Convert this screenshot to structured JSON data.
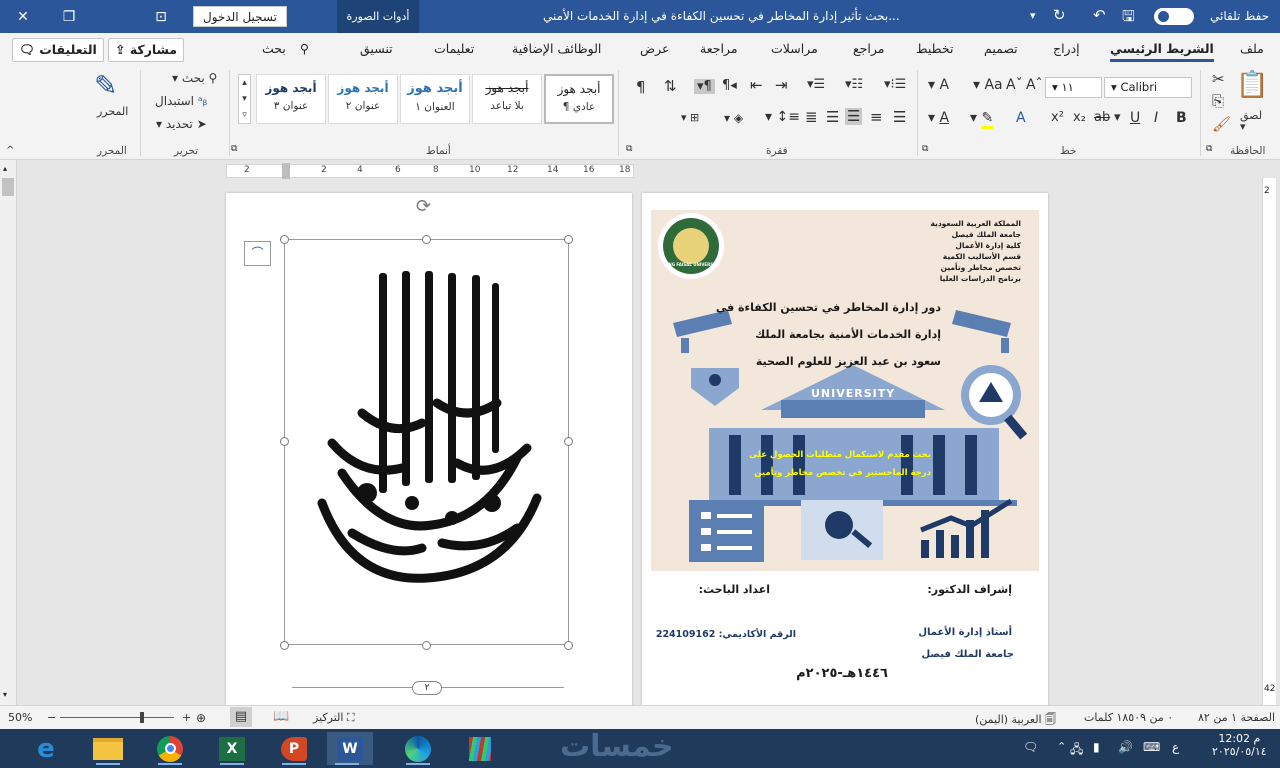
{
  "titlebar": {
    "autosave_label": "حفظ تلقائي",
    "doc_title": "بحث تأثير إدارة المخاطر في تحسين الكفاءة في إدارة الخدمات الأمني...",
    "image_tools": "أدوات الصورة",
    "signin": "تسجيل الدخول"
  },
  "tabs": [
    "ملف",
    "الشريط الرئيسي",
    "إدراج",
    "تصميم",
    "تخطيط",
    "مراجع",
    "مراسلات",
    "مراجعة",
    "عرض",
    "الوظائف الإضافية",
    "تعليمات",
    "تنسيق"
  ],
  "search_label": "بحث",
  "share_label": "مشاركة",
  "comments_label": "التعليقات",
  "ribbon": {
    "clipboard": {
      "paste": "لصق",
      "group": "الحافظة"
    },
    "font": {
      "name": "Calibri",
      "size": "١١",
      "group": "خط"
    },
    "paragraph": {
      "group": "فقرة"
    },
    "styles": {
      "items": [
        {
          "sample": "أبجد هوز",
          "name": "¶ عادي"
        },
        {
          "sample": "أبجد هوز",
          "name": "بلا تباعد"
        },
        {
          "sample": "أبجد هوز",
          "name": "العنوان ١"
        },
        {
          "sample": "أبجد هوز",
          "name": "عنوان ٢"
        },
        {
          "sample": "أبجد هوز",
          "name": "عنوان ٣"
        }
      ],
      "group": "أنماط"
    },
    "editing": {
      "find": "بحث",
      "replace": "استبدال",
      "select": "تحديد",
      "group": "تحرير"
    },
    "editor": {
      "label": "المحرر",
      "group": "المحرر"
    }
  },
  "ruler_ticks": [
    "18",
    "16",
    "14",
    "12",
    "10",
    "8",
    "6",
    "4",
    "2",
    "2"
  ],
  "vruler_ticks": [
    "2",
    "42"
  ],
  "cover": {
    "institution": [
      "المملكة العربية السعودية",
      "جامعة الملك فيصل",
      "كلية إدارة الأعمال",
      "قسم الأساليب الكمية",
      "تخصص مخاطر وتأمين",
      "برنامج الدراسات العليا"
    ],
    "logo_text": "KING FAISAL UNIVERSITY",
    "title_lines": [
      "دور إدارة المخاطر في تحسين الكفاءة في",
      "إدارة الخدمات الأمنية بجامعة الملك",
      "سعود بن عبد العزيز للعلوم الصحية"
    ],
    "university_sign": "UNIVERSITY",
    "submitted_lines": [
      "بحث مقدم لاستكمال متطلبات الحصول على",
      "درجة الماجستير في تخصص مخاطر وتأمين"
    ],
    "supervisor_label": "إشراف الدكتور:",
    "supervisor_title": "أستاذ إدارة الأعمال",
    "supervisor_university": "جامعة الملك فيصل",
    "researcher_label": "اعداد الباحث:",
    "academic_number": "الرقم الأكاديمي: 224109162",
    "year": "١٤٤٦هـ-٢٠٢٥م"
  },
  "page_number": "٢",
  "status": {
    "page": "الصفحة ١ من ٨٢",
    "words": "٠ من ١٨٥٠٩ كلمات",
    "language": "العربية (اليمن)",
    "focus": "التركيز",
    "zoom": "50%",
    "zoom_fraction": 0.5
  },
  "taskbar": {
    "time": "م 12:02",
    "date": "٢٠٢٥/٠٥/١٤",
    "lang": "ع",
    "watermark": "خمسات"
  }
}
